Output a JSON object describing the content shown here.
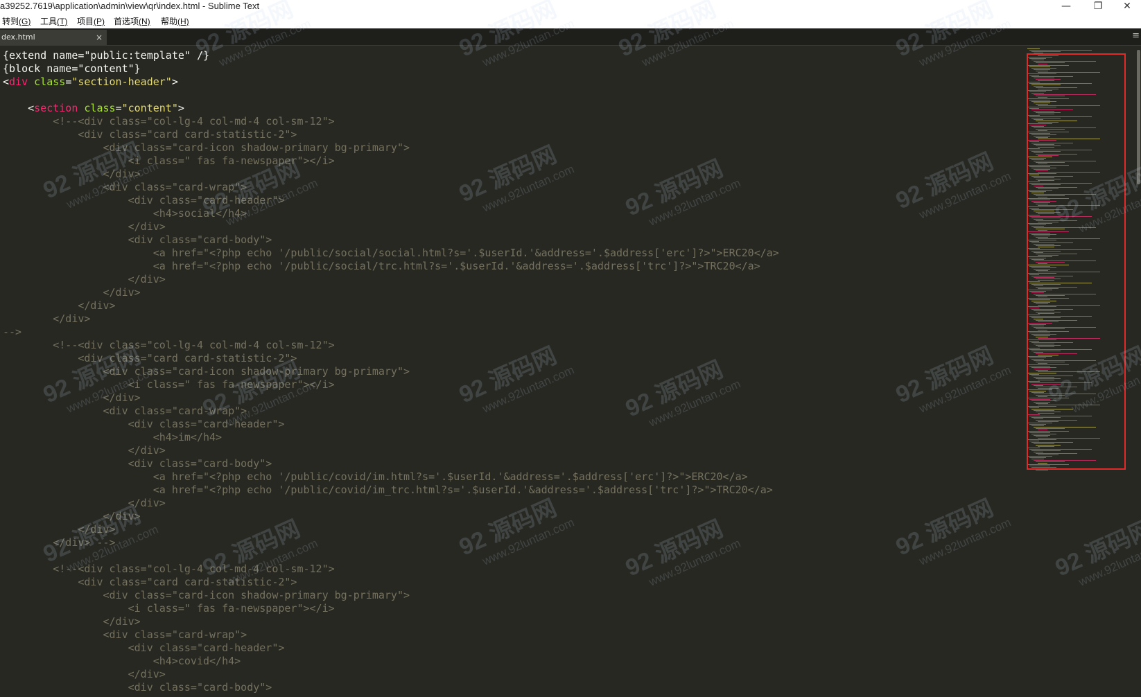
{
  "window": {
    "title": "a39252.7619\\application\\admin\\view\\qr\\index.html - Sublime Text",
    "minimize": "—",
    "restore": "❐",
    "close": "✕"
  },
  "menu": [
    {
      "label": "转到",
      "key": "(G)"
    },
    {
      "label": "工具",
      "key": "(T)"
    },
    {
      "label": "项目",
      "key": "(P)"
    },
    {
      "label": "首选项",
      "key": "(N)"
    },
    {
      "label": "帮助",
      "key": "(H)"
    }
  ],
  "tabs": [
    {
      "label": "dex.html",
      "close": "×"
    }
  ],
  "tab_menu_icon": "≡",
  "watermark": {
    "brand": "92 源码网",
    "url": "www.92luntan.com"
  },
  "code_lines": [
    [
      [
        "",
        "{extend name=\"public:template\" /}"
      ]
    ],
    [
      [
        "",
        "{block name=\"content\"}"
      ]
    ],
    [
      [
        "",
        "<"
      ],
      [
        "tag",
        "div"
      ],
      [
        "attr",
        " class"
      ],
      [
        "",
        "="
      ],
      [
        "str",
        "\"section-header\""
      ],
      [
        "",
        ">"
      ]
    ],
    [
      [
        "",
        ""
      ]
    ],
    [
      [
        "",
        "    <"
      ],
      [
        "tag",
        "section"
      ],
      [
        "attr",
        " class"
      ],
      [
        "",
        "="
      ],
      [
        "str",
        "\"content\""
      ],
      [
        "",
        ">"
      ]
    ],
    [
      [
        "cm",
        "        <!--<div class=\"col-lg-4 col-md-4 col-sm-12\">"
      ]
    ],
    [
      [
        "cm",
        "            <div class=\"card card-statistic-2\">"
      ]
    ],
    [
      [
        "cm",
        "                <div class=\"card-icon shadow-primary bg-primary\">"
      ]
    ],
    [
      [
        "cm",
        "                    <i class=\" fas fa-newspaper\"></i>"
      ]
    ],
    [
      [
        "cm",
        "                </div>"
      ]
    ],
    [
      [
        "cm",
        "                <div class=\"card-wrap\">"
      ]
    ],
    [
      [
        "cm",
        "                    <div class=\"card-header\">"
      ]
    ],
    [
      [
        "cm",
        "                        <h4>social</h4>"
      ]
    ],
    [
      [
        "cm",
        "                    </div>"
      ]
    ],
    [
      [
        "cm",
        "                    <div class=\"card-body\">"
      ]
    ],
    [
      [
        "cm",
        "                        <a href=\"<?php echo '/public/social/social.html?s='.$userId.'&address='.$address['erc']?>\">ERC20</a>"
      ]
    ],
    [
      [
        "cm",
        "                        <a href=\"<?php echo '/public/social/trc.html?s='.$userId.'&address='.$address['trc']?>\">TRC20</a>"
      ]
    ],
    [
      [
        "cm",
        "                    </div>"
      ]
    ],
    [
      [
        "cm",
        "                </div>"
      ]
    ],
    [
      [
        "cm",
        "            </div>"
      ]
    ],
    [
      [
        "cm",
        "        </div>"
      ]
    ],
    [
      [
        "cm",
        "-->"
      ]
    ],
    [
      [
        "cm",
        "        <!--<div class=\"col-lg-4 col-md-4 col-sm-12\">"
      ]
    ],
    [
      [
        "cm",
        "            <div class=\"card card-statistic-2\">"
      ]
    ],
    [
      [
        "cm",
        "                <div class=\"card-icon shadow-primary bg-primary\">"
      ]
    ],
    [
      [
        "cm",
        "                    <i class=\" fas fa-newspaper\"></i>"
      ]
    ],
    [
      [
        "cm",
        "                </div>"
      ]
    ],
    [
      [
        "cm",
        "                <div class=\"card-wrap\">"
      ]
    ],
    [
      [
        "cm",
        "                    <div class=\"card-header\">"
      ]
    ],
    [
      [
        "cm",
        "                        <h4>im</h4>"
      ]
    ],
    [
      [
        "cm",
        "                    </div>"
      ]
    ],
    [
      [
        "cm",
        "                    <div class=\"card-body\">"
      ]
    ],
    [
      [
        "cm",
        "                        <a href=\"<?php echo '/public/covid/im.html?s='.$userId.'&address='.$address['erc']?>\">ERC20</a>"
      ]
    ],
    [
      [
        "cm",
        "                        <a href=\"<?php echo '/public/covid/im_trc.html?s='.$userId.'&address='.$address['trc']?>\">TRC20</a>"
      ]
    ],
    [
      [
        "cm",
        "                    </div>"
      ]
    ],
    [
      [
        "cm",
        "                </div>"
      ]
    ],
    [
      [
        "cm",
        "            </div>"
      ]
    ],
    [
      [
        "cm",
        "        </div> -->"
      ]
    ],
    [
      [
        "",
        ""
      ]
    ],
    [
      [
        "cm",
        "        <!--<div class=\"col-lg-4 col-md-4 col-sm-12\">"
      ]
    ],
    [
      [
        "cm",
        "            <div class=\"card card-statistic-2\">"
      ]
    ],
    [
      [
        "cm",
        "                <div class=\"card-icon shadow-primary bg-primary\">"
      ]
    ],
    [
      [
        "cm",
        "                    <i class=\" fas fa-newspaper\"></i>"
      ]
    ],
    [
      [
        "cm",
        "                </div>"
      ]
    ],
    [
      [
        "cm",
        "                <div class=\"card-wrap\">"
      ]
    ],
    [
      [
        "cm",
        "                    <div class=\"card-header\">"
      ]
    ],
    [
      [
        "cm",
        "                        <h4>covid</h4>"
      ]
    ],
    [
      [
        "cm",
        "                    </div>"
      ]
    ],
    [
      [
        "cm",
        "                    <div class=\"card-body\">"
      ]
    ]
  ]
}
